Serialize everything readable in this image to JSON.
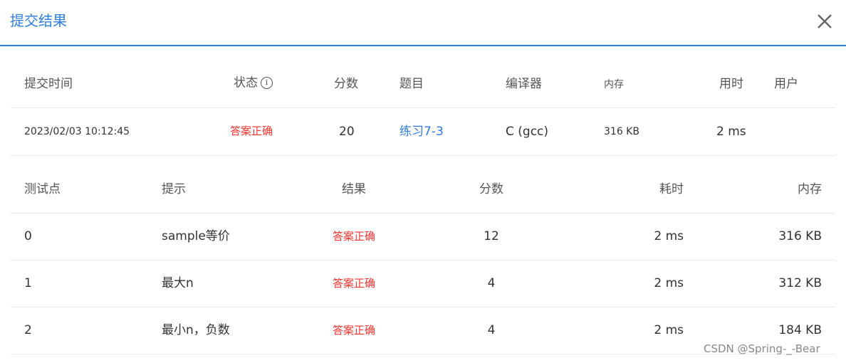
{
  "dialog": {
    "title": "提交结果"
  },
  "summary": {
    "headers": {
      "time": "提交时间",
      "status": "状态",
      "score": "分数",
      "problem": "题目",
      "compiler": "编译器",
      "memory": "内存",
      "duration": "用时",
      "user": "用户"
    },
    "row": {
      "time": "2023/02/03 10:12:45",
      "status": "答案正确",
      "score": "20",
      "problem": "练习7-3",
      "compiler": "C (gcc)",
      "memory": "316 KB",
      "duration": "2 ms",
      "user": ""
    }
  },
  "tests": {
    "headers": {
      "case": "测试点",
      "hint": "提示",
      "result": "结果",
      "score": "分数",
      "time": "耗时",
      "memory": "内存"
    },
    "rows": [
      {
        "case": "0",
        "hint": "sample等价",
        "result": "答案正确",
        "score": "12",
        "time": "2 ms",
        "memory": "316 KB"
      },
      {
        "case": "1",
        "hint": "最大n",
        "result": "答案正确",
        "score": "4",
        "time": "2 ms",
        "memory": "312 KB"
      },
      {
        "case": "2",
        "hint": "最小n，负数",
        "result": "答案正确",
        "score": "4",
        "time": "2 ms",
        "memory": "184 KB"
      }
    ]
  },
  "watermark": "CSDN @Spring-_-Bear"
}
